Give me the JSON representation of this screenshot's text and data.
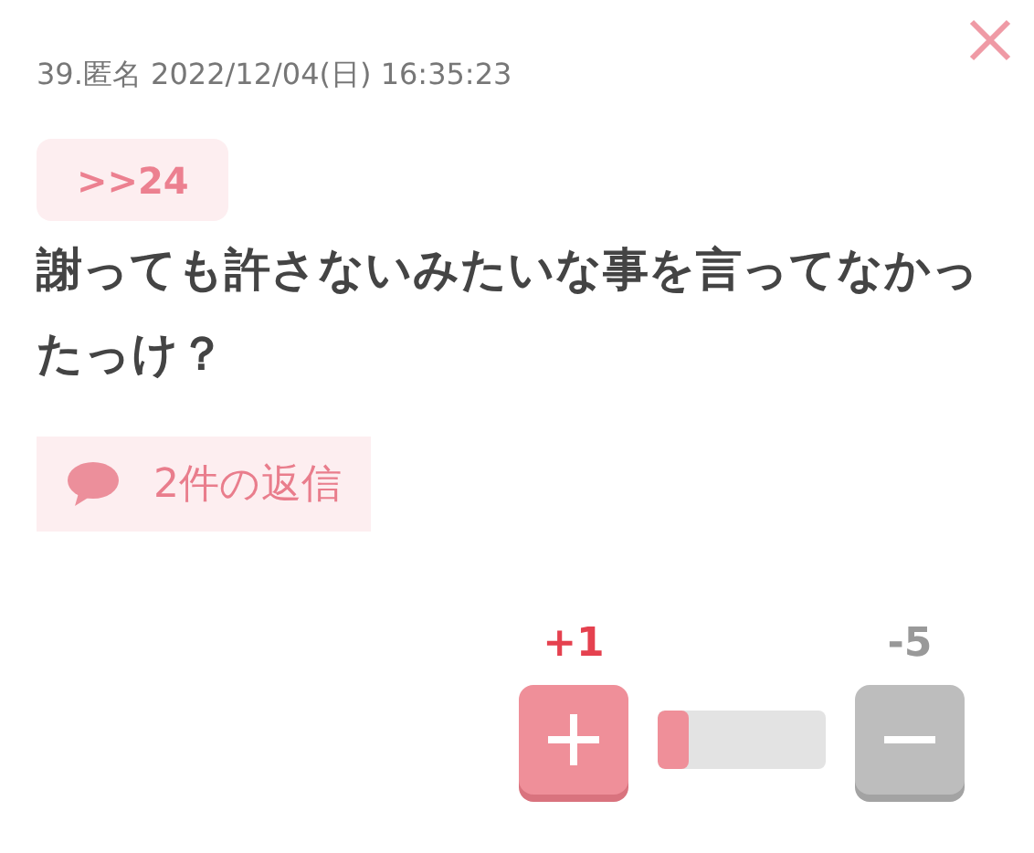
{
  "post": {
    "header": "39.匿名 2022/12/04(日) 16:35:23",
    "anchor": ">>24",
    "body": "謝っても許さないみたいな事を言ってなかったっけ？",
    "replies": "2件の返信"
  },
  "vote": {
    "plus_count": "+1",
    "minus_count": "-5",
    "level": 0.18
  }
}
